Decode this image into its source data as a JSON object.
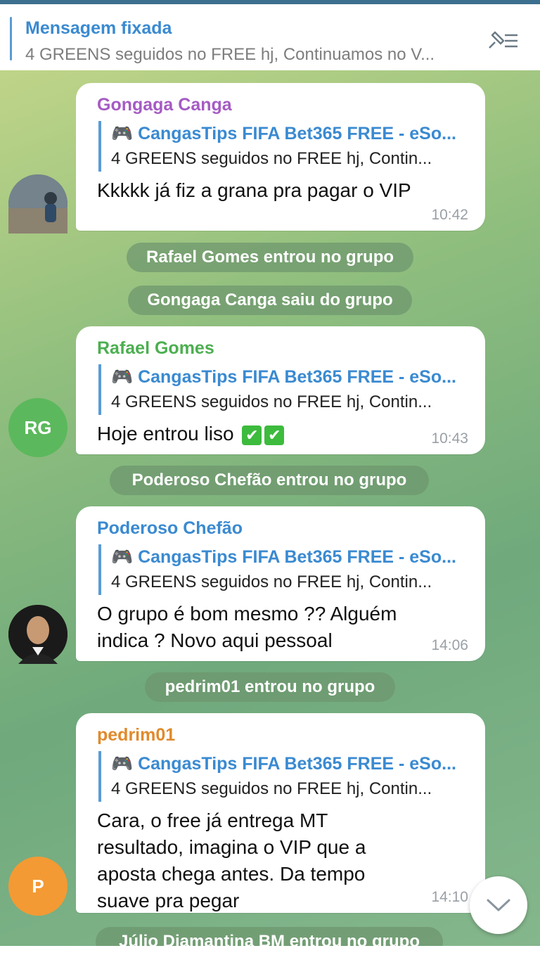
{
  "pinned": {
    "title": "Mensagem fixada",
    "text": "4 GREENS seguidos no FREE hj, Continuamos no V..."
  },
  "reply_preview": {
    "title": "🎮 CangasTips FIFA Bet365 FREE - eSo...",
    "text": "4 GREENS seguidos no FREE hj, Contin..."
  },
  "messages": [
    {
      "sender": "Gongaga Canga",
      "sender_color": "#a55bc4",
      "text": "Kkkkk já fiz a grana pra pagar o VIP",
      "time": "10:42"
    },
    {
      "sender": "Rafael Gomes",
      "sender_color": "#4caf50",
      "text": "Hoje entrou liso",
      "checks": "✔✔",
      "time": "10:43",
      "avatar_initials": "RG",
      "avatar_color": "#5cb85c"
    },
    {
      "sender": "Poderoso Chefão",
      "sender_color": "#3a8ad1",
      "text": "O grupo é bom mesmo ?? Alguém indica ? Novo aqui pessoal",
      "time": "14:06"
    },
    {
      "sender": "pedrim01",
      "sender_color": "#e08a2c",
      "text": "Cara, o free já entrega MT resultado, imagina o VIP que a aposta chega antes. Da tempo suave pra pegar",
      "time": "14:10",
      "avatar_initials": "P",
      "avatar_color": "#f39a34"
    }
  ],
  "service": [
    "Rafael Gomes entrou no grupo",
    "Gongaga Canga saiu do grupo",
    "Poderoso Chefão entrou no grupo",
    "pedrim01 entrou no grupo",
    "Júlio Diamantina BM entrou no grupo"
  ]
}
